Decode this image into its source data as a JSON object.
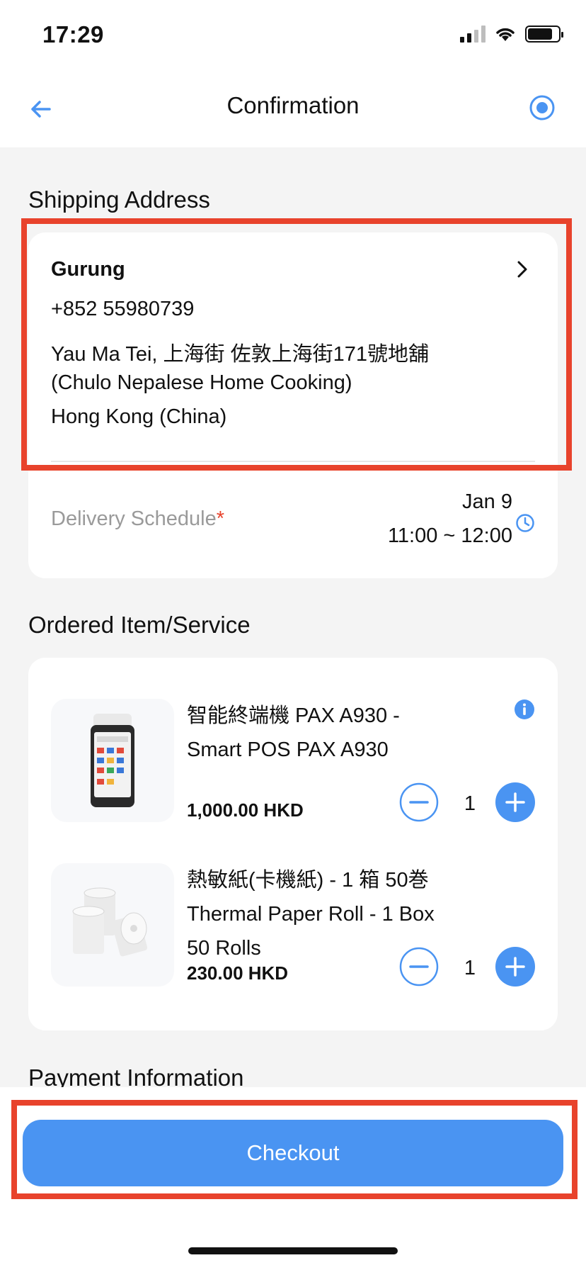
{
  "status_bar": {
    "time": "17:29"
  },
  "header": {
    "title": "Confirmation"
  },
  "shipping": {
    "section_title": "Shipping Address",
    "name": "Gurung",
    "phone": "+852 55980739",
    "address_line1": "Yau Ma Tei, 上海街 佐敦上海街171號地舖",
    "address_line2": "(Chulo Nepalese Home Cooking)",
    "address_line3": "Hong Kong (China)",
    "delivery_label": "Delivery Schedule",
    "delivery_required_mark": "*",
    "delivery_date": "Jan 9",
    "delivery_time": "11:00 ~ 12:00"
  },
  "ordered": {
    "section_title": "Ordered Item/Service",
    "items": [
      {
        "title_line1": "智能終端機 PAX A930 -",
        "title_line2": "Smart POS PAX A930",
        "price": "1,000.00 HKD",
        "quantity": "1"
      },
      {
        "title_line1": "熱敏紙(卡機紙) - 1 箱 50巻",
        "title_line2": "Thermal Paper Roll - 1 Box",
        "title_line3": "50 Rolls",
        "price": "230.00 HKD",
        "quantity": "1"
      }
    ]
  },
  "payment": {
    "section_title": "Payment Information"
  },
  "footer": {
    "checkout_label": "Checkout"
  },
  "colors": {
    "accent": "#4a94f2",
    "highlight": "#e8432c",
    "required": "#e8432c"
  }
}
